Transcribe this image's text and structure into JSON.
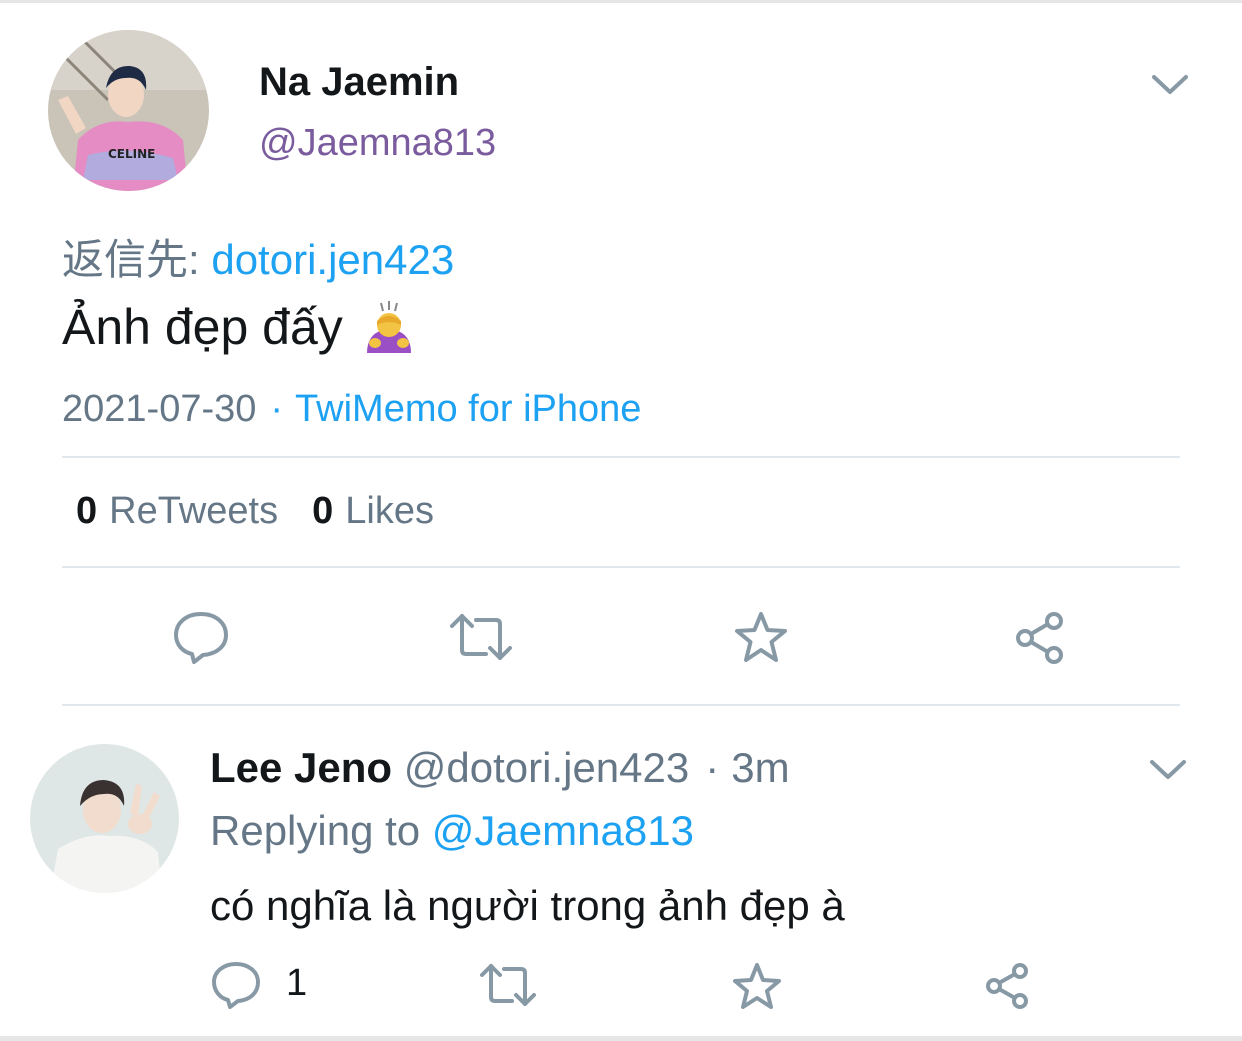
{
  "tweet": {
    "author_name": "Na Jaemin",
    "author_handle": "@Jaemna813",
    "reply_to_label": "返信先:",
    "reply_to_target": "dotori.jen423",
    "text": "Ảnh đẹp đấy",
    "emoji": "person-bowing-emoji",
    "date": "2021-07-30",
    "separator": "·",
    "source": "TwiMemo for iPhone",
    "retweet_count": "0",
    "retweet_label": "ReTweets",
    "like_count": "0",
    "like_label": "Likes"
  },
  "reply": {
    "author_name": "Lee Jeno",
    "author_handle": "@dotori.jen423",
    "separator": "·",
    "time": "3m",
    "replying_label": "Replying to",
    "replying_mention": "@Jaemna813",
    "text": "có nghĩa là người trong ảnh đẹp à",
    "reply_count": "1"
  },
  "icons": {
    "more": "chevron-down-icon",
    "reply": "speech-bubble-icon",
    "retweet": "retweet-icon",
    "like": "star-icon",
    "share": "share-icon"
  },
  "colors": {
    "link": "#1da1f2",
    "muted": "#657786",
    "handle": "#7a5c9e",
    "text": "#14171a",
    "divider": "#e1e8ed"
  }
}
